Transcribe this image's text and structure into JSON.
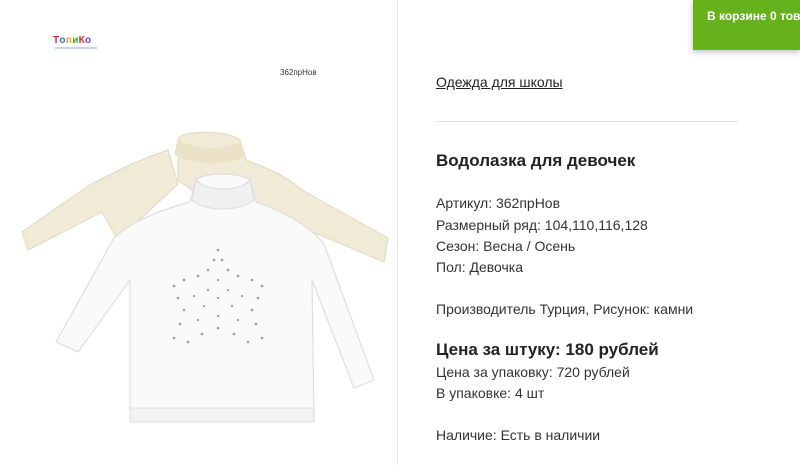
{
  "cart": {
    "label": "В корзине",
    "count": "0",
    "unit": "товаров"
  },
  "logo": {
    "text": "ТопиКо"
  },
  "image": {
    "sku_label": "362прНов"
  },
  "category": {
    "link": "Одежда для школы"
  },
  "product": {
    "title": "Водолазка для девочек",
    "article": "Артикул: 362прНов",
    "sizes": "Размерный ряд: 104,110,116,128",
    "season": "Сезон: Весна / Осень",
    "gender": "Пол: Девочка",
    "manufacturer": "Производитель Турция, Рисунок: камни",
    "price_unit": "Цена за штуку: 180 рублей",
    "price_pack": "Цена за упаковку: 720 рублей",
    "pack_qty": "В упаковке: 4 шт",
    "availability": "Наличие: Есть в наличии"
  },
  "colors": {
    "cart_green": "#66b21c"
  }
}
